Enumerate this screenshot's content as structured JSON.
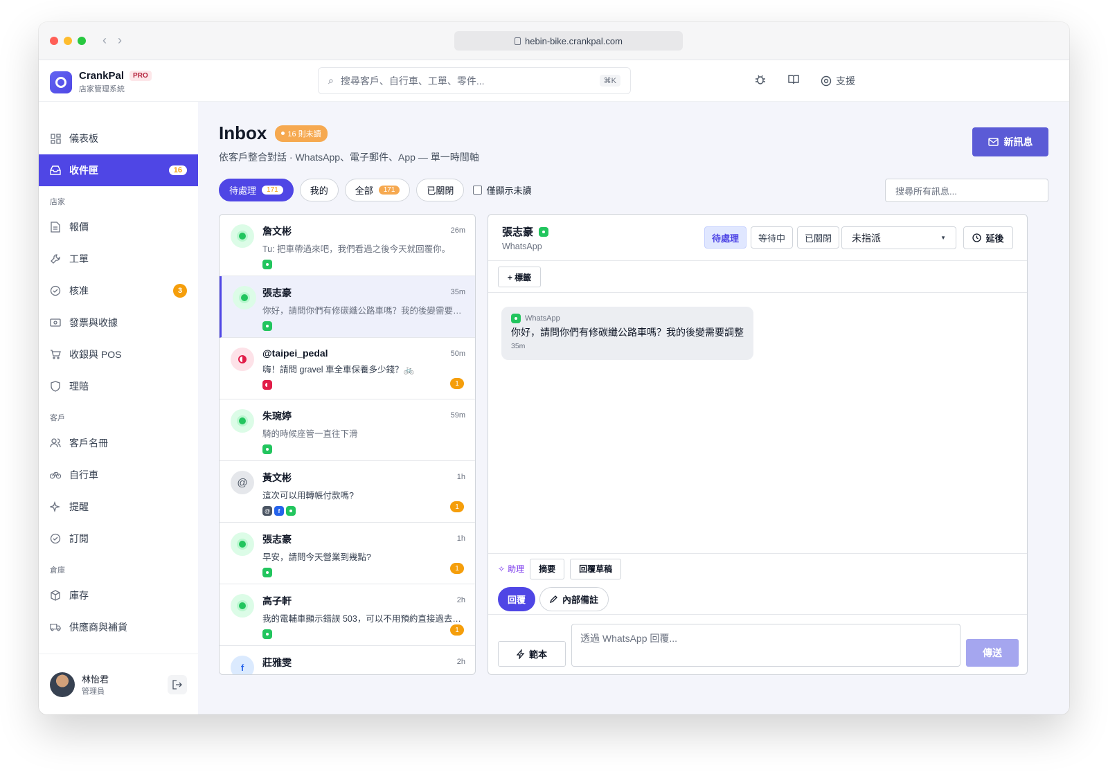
{
  "browser": {
    "url": "hebin-bike.crankpal.com"
  },
  "app": {
    "name": "CrankPal",
    "tier": "PRO",
    "subtitle": "店家管理系統"
  },
  "header": {
    "search_placeholder": "搜尋客戶、自行車、工單、零件...",
    "search_shortcut": "⌘K",
    "support_label": "支援"
  },
  "sidebar": {
    "top": [
      {
        "label": "儀表板"
      },
      {
        "label": "收件匣",
        "badge": "16"
      }
    ],
    "store_section": "店家",
    "store": [
      {
        "label": "報價"
      },
      {
        "label": "工單"
      },
      {
        "label": "核准",
        "badge": "3"
      },
      {
        "label": "發票與收據"
      },
      {
        "label": "收銀與 POS"
      },
      {
        "label": "理賠"
      }
    ],
    "customer_section": "客戶",
    "customer": [
      {
        "label": "客戶名冊"
      },
      {
        "label": "自行車"
      },
      {
        "label": "提醒"
      },
      {
        "label": "訂閱"
      }
    ],
    "warehouse_section": "倉庫",
    "warehouse": [
      {
        "label": "庫存"
      },
      {
        "label": "供應商與補貨"
      }
    ],
    "user": {
      "name": "林怡君",
      "role": "管理員"
    }
  },
  "page": {
    "title": "Inbox",
    "unread_pill": "16 則未讀",
    "subtitle": "依客戶整合對話 · WhatsApp、電子郵件、App — 單一時間軸",
    "new_message": "新訊息",
    "search_all_placeholder": "搜尋所有訊息..."
  },
  "filters": {
    "pending": "待處理",
    "pending_count": "171",
    "mine": "我的",
    "all": "全部",
    "all_count": "171",
    "closed": "已關閉",
    "unread_only": "僅顯示未讀"
  },
  "conversations": [
    {
      "name": "詹文彬",
      "time": "26m",
      "preview": "Tu: 把車帶過來吧，我們看過之後今天就回覆你。"
    },
    {
      "name": "張志豪",
      "time": "35m",
      "preview": "你好，請問你們有修碳纖公路車嗎？我的後變需要調整"
    },
    {
      "name": "@taipei_pedal",
      "time": "50m",
      "preview": "嗨！請問 gravel 車全車保養多少錢？🚲",
      "unread": "1"
    },
    {
      "name": "朱琬婷",
      "time": "59m",
      "preview": "騎的時候座管一直往下滑"
    },
    {
      "name": "黃文彬",
      "time": "1h",
      "preview": "這次可以用轉帳付款嗎?",
      "unread": "1"
    },
    {
      "name": "張志豪",
      "time": "1h",
      "preview": "早安，請問今天營業到幾點?",
      "unread": "1"
    },
    {
      "name": "高子軒",
      "time": "2h",
      "preview": "我的電輔車顯示錯誤 503，可以不用預約直接過去嗎？",
      "unread": "1"
    },
    {
      "name": "莊雅雯",
      "time": "2h",
      "preview": ""
    }
  ],
  "thread": {
    "name": "張志豪",
    "channel": "WhatsApp",
    "status_pending": "待處理",
    "status_waiting": "等待中",
    "status_closed": "已關閉",
    "assignee": "未指派",
    "snooze": "延後",
    "add_tag": "+ 標籤",
    "message": {
      "source": "WhatsApp",
      "text": "你好，請問你們有修碳纖公路車嗎？我的後變需要調整",
      "time": "35m"
    },
    "assist_label": "助理",
    "summary": "摘要",
    "draft_reply": "回覆草稿",
    "reply_tab": "回覆",
    "note_tab": "內部備註",
    "template": "範本",
    "reply_placeholder": "透過 WhatsApp 回覆...",
    "send": "傳送"
  }
}
